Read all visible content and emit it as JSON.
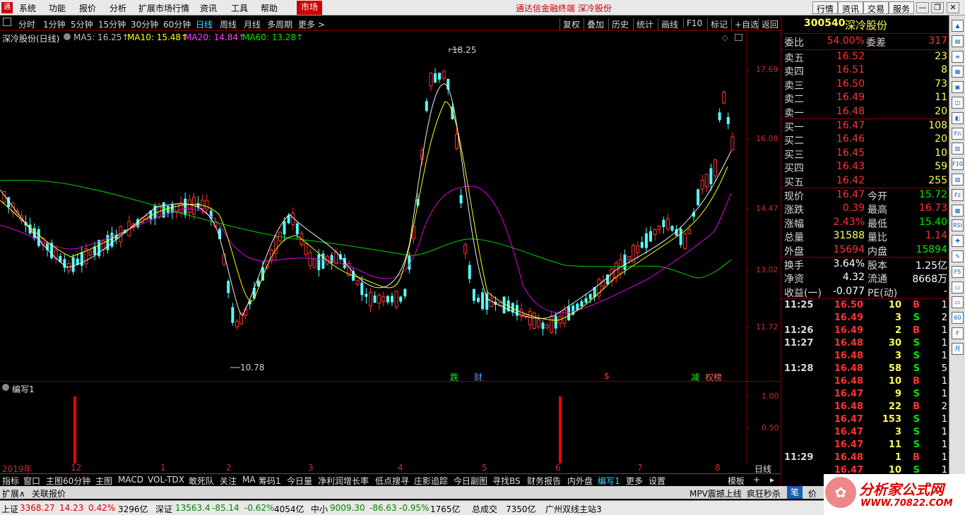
{
  "menu": {
    "items": [
      "系统",
      "功能",
      "报价",
      "分析",
      "扩展市场行情",
      "资讯",
      "工具",
      "帮助"
    ],
    "market": "市场",
    "title": "通达信金融终端  深冷股份",
    "right": [
      "行情",
      "资讯",
      "交易",
      "服务"
    ]
  },
  "toolbar": {
    "periods": [
      "分时",
      "1分钟",
      "5分钟",
      "15分钟",
      "30分钟",
      "60分钟",
      "日线",
      "周线",
      "月线",
      "多周期",
      "更多 >"
    ],
    "buttons": [
      "复权",
      "叠加",
      "历史",
      "统计",
      "画线",
      "F10",
      "标记",
      "+自选",
      "返回"
    ]
  },
  "chart": {
    "name": "深冷股份(日线)",
    "ma": [
      {
        "label": "MA5: 16.25↑",
        "color": "#ffffff"
      },
      {
        "label": "MA10: 15.48↑",
        "color": "#ffff00"
      },
      {
        "label": "MA20: 14.84↑",
        "color": "#ff00ff"
      },
      {
        "label": "MA60: 13.28↑",
        "color": "#00e600"
      }
    ],
    "prices": [
      "17.69",
      "16.08",
      "14.47",
      "13.02",
      "11.72"
    ],
    "high_label": "18.25",
    "low_label": "10.78",
    "events": [
      {
        "text": "跌",
        "color": "#00ff00"
      },
      {
        "text": "财",
        "color": "#4a9aff"
      },
      {
        "text": "$",
        "color": "#ff3232"
      },
      {
        "text": "减",
        "color": "#00ff00"
      },
      {
        "text": "权榜",
        "color": "#ff6060"
      }
    ]
  },
  "indicator": {
    "name": "编写1",
    "levels": [
      "1.00",
      "0.50"
    ]
  },
  "xaxis": {
    "labels": [
      "2019年",
      "12",
      "1",
      "2",
      "3",
      "4",
      "5",
      "6",
      "7",
      "8"
    ],
    "mode": "日线"
  },
  "tabs": [
    "指标",
    "窗口",
    "主图60分钟",
    "主图",
    "MACD",
    "VOL-TDX",
    "敢死队",
    "关注",
    "MA",
    "筹码1",
    "今日量",
    "净利润增长率",
    "低点搜寻",
    "庄影追踪",
    "今日副图",
    "寻找BS",
    "财务报告",
    "内外盘",
    "编写1",
    "更多",
    "设置",
    "模板",
    "+",
    "▸"
  ],
  "bottom1": {
    "left": [
      "扩展∧",
      "关联报价"
    ],
    "right": [
      "MPV震撼上线",
      "疯狂秒杀",
      "笔",
      "价"
    ]
  },
  "bottom2": {
    "items": [
      {
        "t": "上证",
        "c": "#000"
      },
      {
        "t": "3368.27",
        "c": "#d00"
      },
      {
        "t": "14.23",
        "c": "#d00"
      },
      {
        "t": "0.42%",
        "c": "#d00"
      },
      {
        "t": "3296亿",
        "c": "#000"
      },
      {
        "t": "深证",
        "c": "#000"
      },
      {
        "t": "13563.4",
        "c": "#080"
      },
      {
        "t": "-85.14",
        "c": "#080"
      },
      {
        "t": "-0.62%",
        "c": "#080"
      },
      {
        "t": "4054亿",
        "c": "#000"
      },
      {
        "t": "中小",
        "c": "#000"
      },
      {
        "t": "9009.30",
        "c": "#080"
      },
      {
        "t": "-86.63",
        "c": "#080"
      },
      {
        "t": "-0.95%",
        "c": "#080"
      },
      {
        "t": "1765亿",
        "c": "#000"
      },
      {
        "t": "总成交",
        "c": "#000"
      },
      {
        "t": "7350亿",
        "c": "#000"
      },
      {
        "t": "广州双线主站3",
        "c": "#000"
      }
    ],
    "logo1": "分析家公式网",
    "logo2": "WWW.70822.COM"
  },
  "quote": {
    "code": "300540",
    "name": "深冷股份",
    "wb": {
      "l1": "委比",
      "v1": "54.00%",
      "l2": "委差",
      "v2": "317"
    },
    "sell": [
      {
        "l": "卖五",
        "p": "16.52",
        "q": "23"
      },
      {
        "l": "卖四",
        "p": "16.51",
        "q": "8"
      },
      {
        "l": "卖三",
        "p": "16.50",
        "q": "73"
      },
      {
        "l": "卖二",
        "p": "16.49",
        "q": "11"
      },
      {
        "l": "卖一",
        "p": "16.48",
        "q": "20"
      }
    ],
    "buy": [
      {
        "l": "买一",
        "p": "16.47",
        "q": "108"
      },
      {
        "l": "买二",
        "p": "16.46",
        "q": "20"
      },
      {
        "l": "买三",
        "p": "16.45",
        "q": "10"
      },
      {
        "l": "买四",
        "p": "16.43",
        "q": "59"
      },
      {
        "l": "买五",
        "p": "16.42",
        "q": "255"
      }
    ],
    "info": [
      {
        "l1": "现价",
        "v1": "16.47",
        "c1": "#ff3232",
        "l2": "今开",
        "v2": "15.72",
        "c2": "#00e600"
      },
      {
        "l1": "涨跌",
        "v1": "0.39",
        "c1": "#ff3232",
        "l2": "最高",
        "v2": "16.73",
        "c2": "#ff3232"
      },
      {
        "l1": "涨幅",
        "v1": "2.43%",
        "c1": "#ff3232",
        "l2": "最低",
        "v2": "15.40",
        "c2": "#00e600"
      },
      {
        "l1": "总量",
        "v1": "31588",
        "c1": "#ffff54",
        "l2": "量比",
        "v2": "1.14",
        "c2": "#ff3232"
      },
      {
        "l1": "外盘",
        "v1": "15694",
        "c1": "#ff3232",
        "l2": "内盘",
        "v2": "15894",
        "c2": "#00e600"
      }
    ],
    "info2": [
      {
        "l1": "换手",
        "v1": "3.64%",
        "l2": "股本",
        "v2": "1.25亿"
      },
      {
        "l1": "净资",
        "v1": "4.32",
        "l2": "流通",
        "v2": "8668万"
      },
      {
        "l1": "收益(一)",
        "v1": "-0.077",
        "l2": "PE(动)",
        "v2": "-"
      }
    ],
    "ticks": [
      {
        "t": "11:25",
        "p": "16.50",
        "q": "10",
        "s": "B",
        "n": "1"
      },
      {
        "t": "",
        "p": "16.49",
        "q": "3",
        "s": "S",
        "n": "2"
      },
      {
        "t": "11:26",
        "p": "16.49",
        "q": "2",
        "s": "B",
        "n": "1"
      },
      {
        "t": "11:27",
        "p": "16.48",
        "q": "30",
        "s": "S",
        "n": "1"
      },
      {
        "t": "",
        "p": "16.48",
        "q": "3",
        "s": "S",
        "n": "1"
      },
      {
        "t": "11:28",
        "p": "16.48",
        "q": "58",
        "s": "S",
        "n": "5"
      },
      {
        "t": "",
        "p": "16.48",
        "q": "10",
        "s": "B",
        "n": "1"
      },
      {
        "t": "",
        "p": "16.47",
        "q": "9",
        "s": "S",
        "n": "1"
      },
      {
        "t": "",
        "p": "16.48",
        "q": "22",
        "s": "B",
        "n": "2"
      },
      {
        "t": "",
        "p": "16.47",
        "q": "153",
        "s": "S",
        "n": "1"
      },
      {
        "t": "",
        "p": "16.47",
        "q": "3",
        "s": "S",
        "n": "1"
      },
      {
        "t": "",
        "p": "16.47",
        "q": "11",
        "s": "S",
        "n": "1"
      },
      {
        "t": "11:29",
        "p": "16.48",
        "q": "1",
        "s": "B",
        "n": "1"
      },
      {
        "t": "",
        "p": "16.47",
        "q": "10",
        "s": "S",
        "n": "1"
      }
    ]
  },
  "sidebar": [
    "▲",
    "▤",
    "≡",
    "▦",
    "▣",
    "◫",
    "◧",
    "Fn",
    "▥",
    "F10",
    "▨",
    "Fz",
    "▩",
    "RSI",
    "✚",
    "✎",
    "F5",
    "▭",
    "▭",
    "60",
    "F",
    "月"
  ]
}
